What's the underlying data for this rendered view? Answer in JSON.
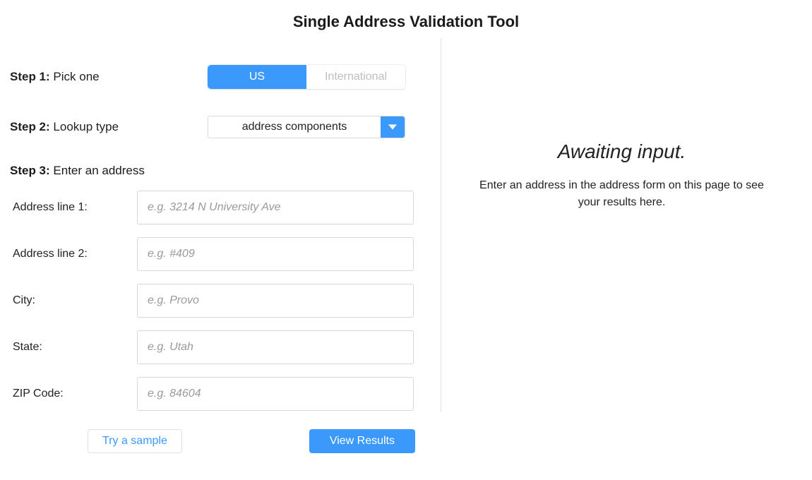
{
  "title": "Single Address Validation Tool",
  "steps": {
    "step1": {
      "label_bold": "Step 1:",
      "label_rest": " Pick one",
      "options": {
        "us": "US",
        "intl": "International"
      }
    },
    "step2": {
      "label_bold": "Step 2:",
      "label_rest": " Lookup type",
      "selected": "address components"
    },
    "step3": {
      "label_bold": "Step 3:",
      "label_rest": " Enter an address"
    }
  },
  "fields": {
    "line1": {
      "label": "Address line 1:",
      "placeholder": "e.g. 3214 N University Ave",
      "value": ""
    },
    "line2": {
      "label": "Address line 2:",
      "placeholder": "e.g. #409",
      "value": ""
    },
    "city": {
      "label": "City:",
      "placeholder": "e.g. Provo",
      "value": ""
    },
    "state": {
      "label": "State:",
      "placeholder": "e.g. Utah",
      "value": ""
    },
    "zip": {
      "label": "ZIP Code:",
      "placeholder": "e.g. 84604",
      "value": ""
    }
  },
  "buttons": {
    "sample": "Try a sample",
    "view": "View Results"
  },
  "results": {
    "heading": "Awaiting input.",
    "hint": "Enter an address in the address form on this page to see your results here."
  }
}
